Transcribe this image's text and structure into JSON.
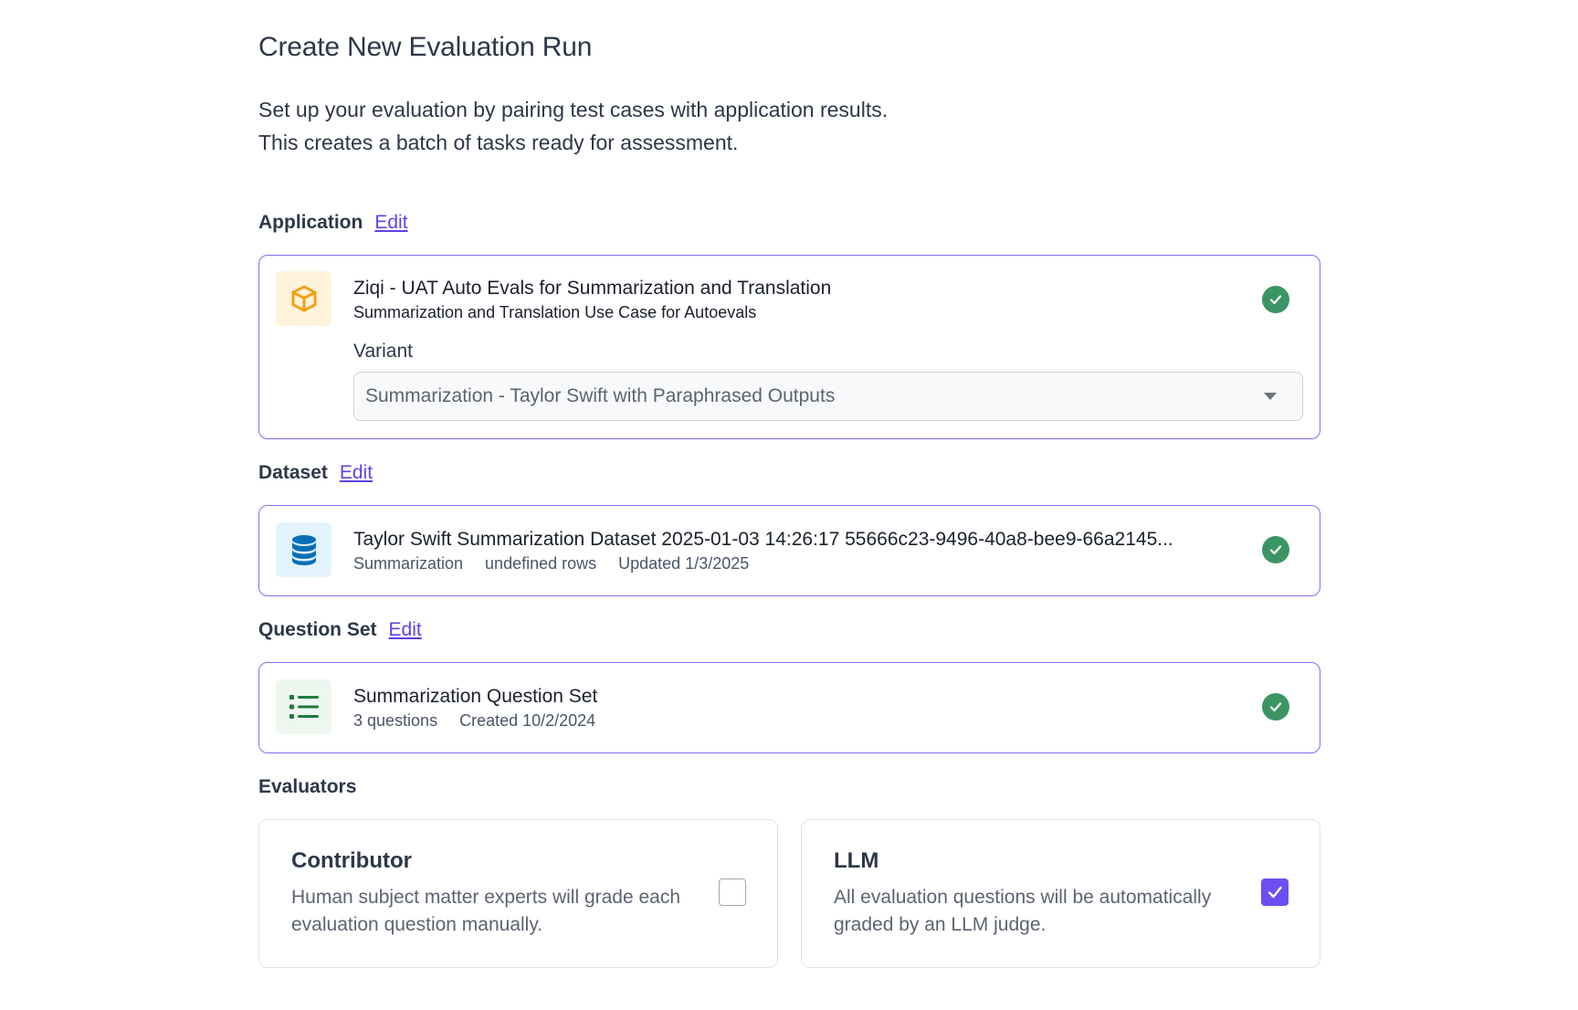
{
  "page": {
    "title": "Create New Evaluation Run",
    "intro_line1": "Set up your evaluation by pairing test cases with application results.",
    "intro_line2": "This creates a batch of tasks ready for assessment."
  },
  "application": {
    "section_label": "Application",
    "edit_label": "Edit",
    "title": "Ziqi - UAT Auto Evals for Summarization and Translation",
    "subtitle": "Summarization and Translation Use Case for Autoevals",
    "variant_label": "Variant",
    "variant_selected": "Summarization - Taylor Swift with Paraphrased Outputs",
    "icon": "cube-icon",
    "status": "complete"
  },
  "dataset": {
    "section_label": "Dataset",
    "edit_label": "Edit",
    "title": "Taylor Swift Summarization Dataset 2025-01-03 14:26:17 55666c23-9496-40a8-bee9-66a2145...",
    "type": "Summarization",
    "rows": "undefined rows",
    "updated": "Updated 1/3/2025",
    "icon": "database-icon",
    "status": "complete"
  },
  "question_set": {
    "section_label": "Question Set",
    "edit_label": "Edit",
    "title": "Summarization Question Set",
    "count": "3 questions",
    "created": "Created 10/2/2024",
    "icon": "list-icon",
    "status": "complete"
  },
  "evaluators": {
    "section_label": "Evaluators",
    "contributor": {
      "title": "Contributor",
      "description": "Human subject matter experts will grade each evaluation question manually.",
      "checked": false
    },
    "llm": {
      "title": "LLM",
      "description": "All evaluation questions will be automatically graded by an LLM judge.",
      "checked": true
    }
  },
  "colors": {
    "accent": "#5a45e6",
    "card_border": "#7f6ff0",
    "success": "#3b9563",
    "checkbox_on": "#6c4ef2"
  }
}
